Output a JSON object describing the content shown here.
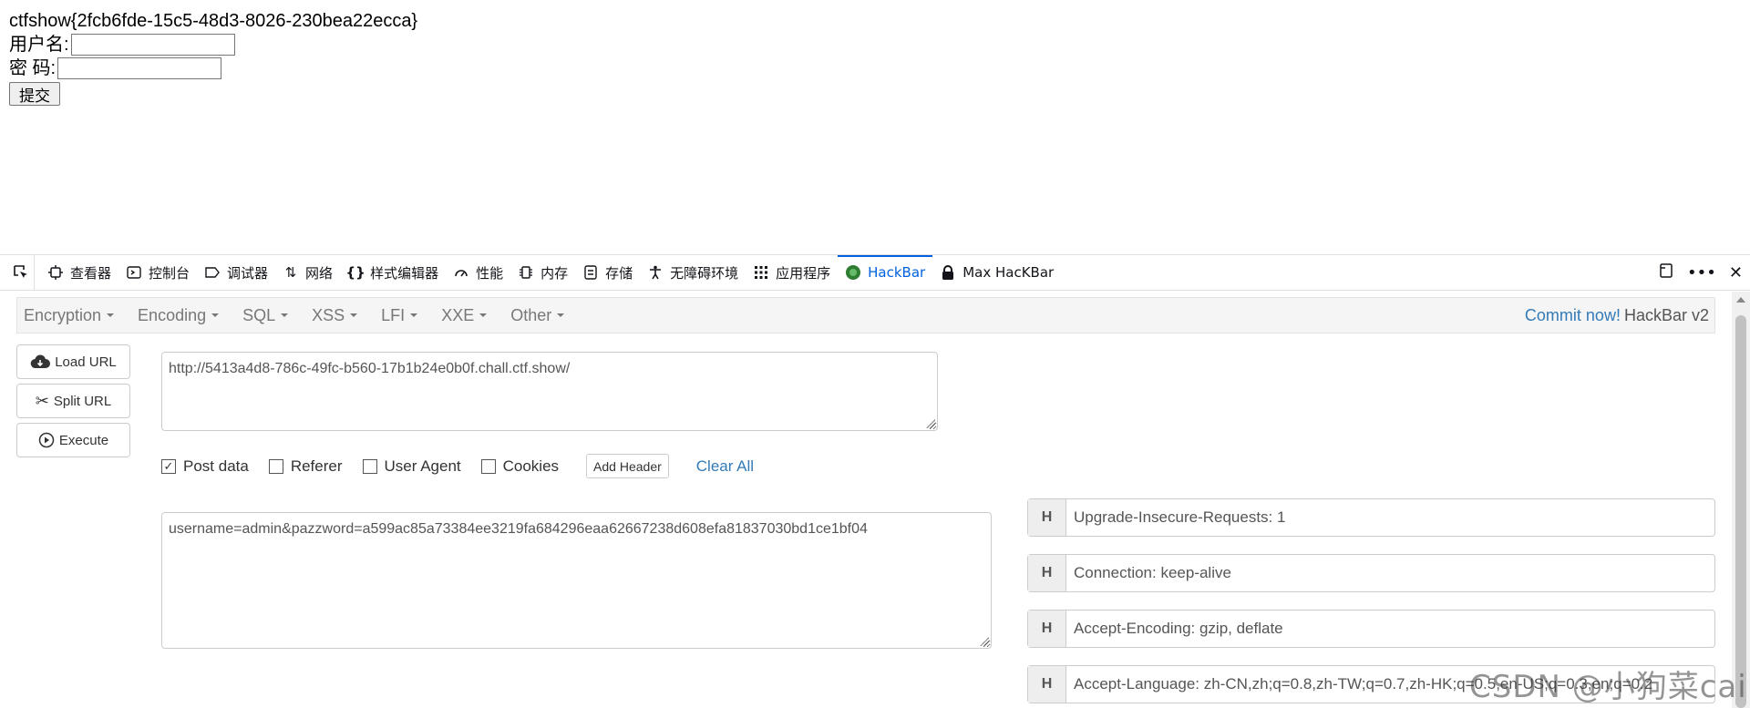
{
  "page": {
    "flag": "ctfshow{2fcb6fde-15c5-48d3-8026-230bea22ecca}",
    "username_label": "用户名:",
    "password_label": "密 码:",
    "username_value": "",
    "password_value": "",
    "submit_label": "提交"
  },
  "devtools": {
    "tabs": [
      {
        "label": "查看器",
        "icon": "inspector-icon"
      },
      {
        "label": "控制台",
        "icon": "console-icon"
      },
      {
        "label": "调试器",
        "icon": "debugger-icon"
      },
      {
        "label": "网络",
        "icon": "network-icon"
      },
      {
        "label": "样式编辑器",
        "icon": "style-editor-icon"
      },
      {
        "label": "性能",
        "icon": "performance-icon"
      },
      {
        "label": "内存",
        "icon": "memory-icon"
      },
      {
        "label": "存储",
        "icon": "storage-icon"
      },
      {
        "label": "无障碍环境",
        "icon": "accessibility-icon"
      },
      {
        "label": "应用程序",
        "icon": "application-icon"
      },
      {
        "label": "HackBar",
        "icon": "hackbar-icon"
      },
      {
        "label": "Max HacKBar",
        "icon": "max-hackbar-icon"
      }
    ],
    "active_tab": "HackBar",
    "accent_color": "#0060df"
  },
  "hackbar": {
    "menu": [
      "Encryption",
      "Encoding",
      "SQL",
      "XSS",
      "LFI",
      "XXE",
      "Other"
    ],
    "commit_link": "Commit now!",
    "brand": "HackBar v2",
    "buttons": {
      "load_url": "Load URL",
      "split_url": "Split URL",
      "execute": "Execute"
    },
    "url": "http://5413a4d8-786c-49fc-b560-17b1b24e0b0f.chall.ctf.show/",
    "options": {
      "post_data": "Post data",
      "referer": "Referer",
      "user_agent": "User Agent",
      "cookies": "Cookies",
      "post_data_checked": true,
      "referer_checked": false,
      "user_agent_checked": false,
      "cookies_checked": false
    },
    "add_header": "Add Header",
    "clear_all": "Clear All",
    "post_body": "username=admin&pazzword=a599ac85a73384ee3219fa684296eaa62667238d608efa81837030bd1ce1bf04",
    "headers": [
      {
        "tag": "H",
        "value": "Upgrade-Insecure-Requests: 1"
      },
      {
        "tag": "H",
        "value": "Connection: keep-alive"
      },
      {
        "tag": "H",
        "value": "Accept-Encoding: gzip, deflate"
      },
      {
        "tag": "H",
        "value": "Accept-Language: zh-CN,zh;q=0.8,zh-TW;q=0.7,zh-HK;q=0.5,en-US;q=0.3,en;q=0.2"
      }
    ]
  },
  "watermark": "CSDN @小狗菜cai"
}
